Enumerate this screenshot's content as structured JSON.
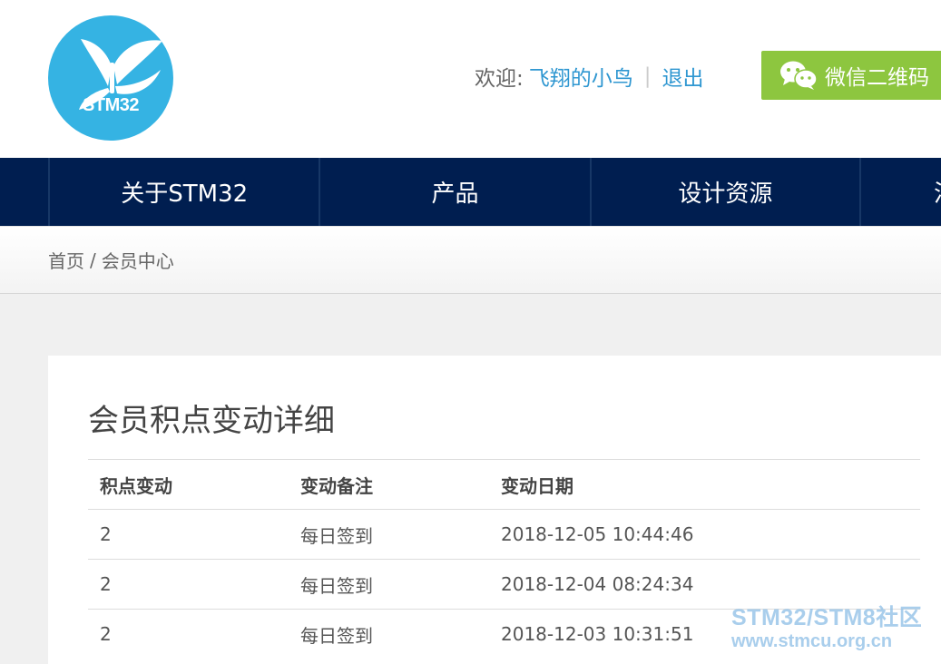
{
  "header": {
    "logo_text": "STM32",
    "welcome_label": "欢迎:",
    "username": "飞翔的小鸟",
    "separator": "|",
    "logout_label": "退出",
    "wechat_label": "微信二维码"
  },
  "nav": {
    "items": [
      {
        "label": "关于STM32"
      },
      {
        "label": "产品"
      },
      {
        "label": "设计资源"
      },
      {
        "label": "活"
      }
    ]
  },
  "breadcrumb": {
    "home": "首页",
    "slash": "/",
    "current": "会员中心"
  },
  "panel": {
    "title": "会员积点变动详细",
    "columns": [
      "积点变动",
      "变动备注",
      "变动日期"
    ],
    "rows": [
      {
        "points": "2",
        "note": "每日签到",
        "date": "2018-12-05 10:44:46"
      },
      {
        "points": "2",
        "note": "每日签到",
        "date": "2018-12-04 08:24:34"
      },
      {
        "points": "2",
        "note": "每日签到",
        "date": "2018-12-03 10:31:51"
      }
    ]
  },
  "watermark": {
    "line1": "STM32/STM8社区",
    "line2": "www.stmcu.org.cn"
  },
  "colors": {
    "nav_bg": "#001e50",
    "accent_blue": "#2f97d1",
    "wechat_green": "#8dc63f",
    "logo_blue": "#35b3e3"
  },
  "icons": {
    "logo": "butterfly-icon",
    "wechat": "wechat-icon"
  }
}
